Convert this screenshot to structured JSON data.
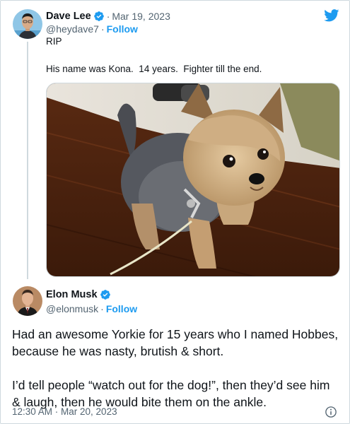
{
  "original_tweet": {
    "display_name": "Dave Lee",
    "date": "Mar 19, 2023",
    "handle": "@heydave7",
    "follow_label": "Follow",
    "caption": "RIP",
    "quoted_text": "His name was Kona.  14 years.  Fighter till the end."
  },
  "reply_tweet": {
    "display_name": "Elon Musk",
    "handle": "@elonmusk",
    "follow_label": "Follow",
    "paragraph_1": "Had an awesome Yorkie for 15 years who I named Hobbes, because he was nasty, brutish & short.",
    "paragraph_2": "I’d tell people “watch out for the dog!”, then they’d see him & laugh, then he would bite them on the ankle.",
    "timestamp": "12:30 AM · Mar 20, 2023"
  },
  "separator": "·",
  "icons": {
    "brand": "twitter-bird-icon",
    "verified": "verified-badge-icon",
    "info": "info-icon"
  },
  "colors": {
    "accent": "#1d9bf0",
    "text": "#0f1419",
    "muted": "#536471",
    "border": "#cfd9de"
  }
}
